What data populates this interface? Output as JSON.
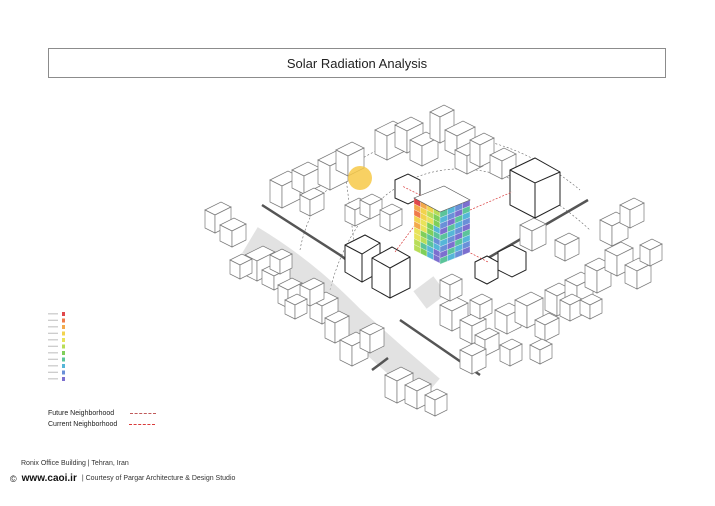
{
  "title": "Solar Radiation Analysis",
  "legend": {
    "future_label": "Future Neighborhood",
    "current_label": "Current Neighborhood",
    "future_color": "#c05a5a",
    "current_color": "#d93a3a"
  },
  "scale_colors": [
    "#e0474c",
    "#ef7b4a",
    "#f3a94c",
    "#f2d34e",
    "#e8e35a",
    "#b8dd58",
    "#7fcf5a",
    "#5bc49a",
    "#56b6d8",
    "#6a90d8",
    "#7c6fcf"
  ],
  "footer": {
    "project": "Ronix Office Building | Tehran, Iran",
    "copyright_symbol": "©",
    "site": "www.caoi.ir",
    "credit": "| Courtesy of Pargar Architecture & Design Studio"
  },
  "sun_color": "#f7c948"
}
